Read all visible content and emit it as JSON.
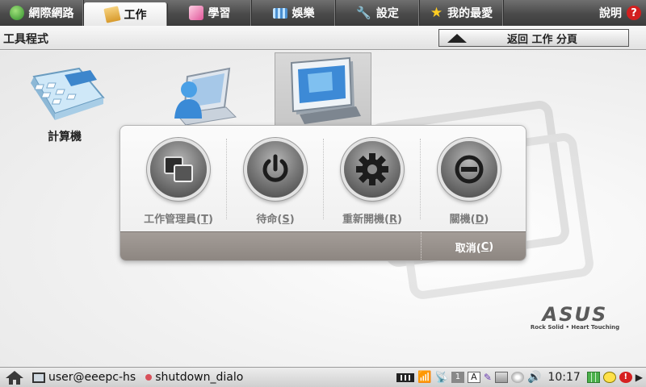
{
  "tabs": [
    {
      "label": "網際網路",
      "icon": "globe-icon",
      "active": false
    },
    {
      "label": "工作",
      "icon": "folder-icon",
      "active": true
    },
    {
      "label": "學習",
      "icon": "pencil-icon",
      "active": false
    },
    {
      "label": "娛樂",
      "icon": "film-icon",
      "active": false
    },
    {
      "label": "設定",
      "icon": "wrench-icon",
      "active": false
    },
    {
      "label": "我的最愛",
      "icon": "star-icon",
      "active": false
    }
  ],
  "help": {
    "label": "說明",
    "badge": "?"
  },
  "section": {
    "title": "工具程式",
    "back_label": "返回 工作 分頁"
  },
  "apps": [
    {
      "label": "計算機",
      "icon": "calculator-icon"
    },
    {
      "label": "",
      "icon": "user-laptop-icon"
    },
    {
      "label": "",
      "icon": "window-icon"
    }
  ],
  "dialog": {
    "buttons": [
      {
        "label": "工作管理員(",
        "key": "T",
        "suffix": ")",
        "icon": "task-manager-icon"
      },
      {
        "label": "待命(",
        "key": "S",
        "suffix": ")",
        "icon": "power-icon"
      },
      {
        "label": "重新開機(",
        "key": "R",
        "suffix": ")",
        "icon": "restart-gear-icon"
      },
      {
        "label": "關機(",
        "key": "D",
        "suffix": ")",
        "icon": "shutdown-icon"
      }
    ],
    "cancel": {
      "label": "取消(",
      "key": "C",
      "suffix": ")"
    }
  },
  "logo": {
    "text": "ASUS",
    "tagline": "Rock Solid • Heart Touching"
  },
  "taskbar": {
    "windows": [
      {
        "label": "user@eeepc-hs",
        "icon": "terminal-icon"
      },
      {
        "label": "shutdown_dialo",
        "icon": "dialog-icon"
      }
    ],
    "clock": "10:17"
  },
  "colors": {
    "active_tab_bg": "#ffffff",
    "footer": "#9a938e",
    "help_badge": "#d21f1f"
  }
}
